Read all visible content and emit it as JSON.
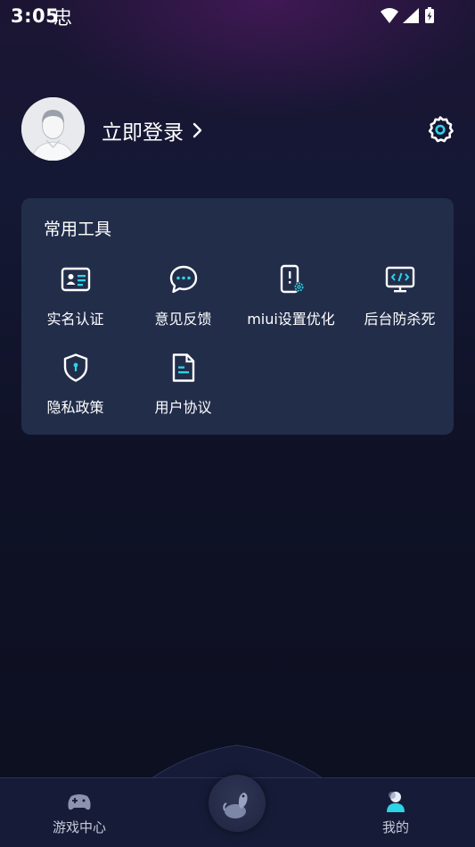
{
  "status": {
    "time": "3:05",
    "extra_glyph": "忠"
  },
  "profile": {
    "login_label": "立即登录"
  },
  "tools": {
    "title": "常用工具",
    "items": [
      {
        "label": "实名认证",
        "icon": "id-card-icon"
      },
      {
        "label": "意见反馈",
        "icon": "chat-bubble-icon"
      },
      {
        "label": "miui设置优化",
        "icon": "phone-settings-icon"
      },
      {
        "label": "后台防杀死",
        "icon": "monitor-code-icon"
      },
      {
        "label": "隐私政策",
        "icon": "shield-icon"
      },
      {
        "label": "用户协议",
        "icon": "document-icon"
      }
    ]
  },
  "tabbar": {
    "tabs": [
      {
        "label": "游戏中心",
        "icon": "gamepad-icon"
      },
      {
        "label": "",
        "icon": "mascot-icon"
      },
      {
        "label": "我的",
        "icon": "user-icon"
      }
    ]
  },
  "colors": {
    "accent": "#2ed3e6",
    "card": "#222d4a"
  }
}
